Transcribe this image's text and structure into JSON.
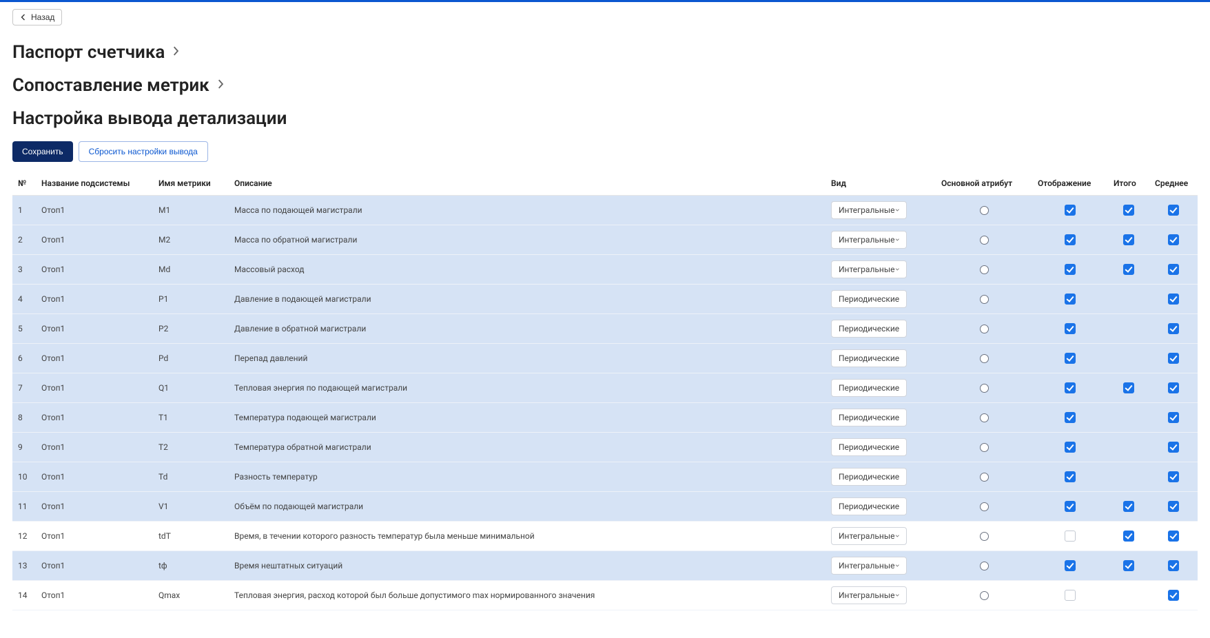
{
  "back_label": "Назад",
  "section1_title": "Паспорт счетчика",
  "section2_title": "Сопоставление метрик",
  "section3_title": "Настройка вывода детализации",
  "actions": {
    "save": "Сохранить",
    "reset": "Сбросить настройки вывода"
  },
  "table": {
    "headers": {
      "idx": "№",
      "subsystem": "Название подсистемы",
      "metric": "Имя метрики",
      "desc": "Описание",
      "kind": "Вид",
      "main_attr": "Основной атрибут",
      "display": "Отображение",
      "total": "Итого",
      "avg": "Среднее"
    },
    "kinds": {
      "integral": "Интегральные",
      "periodic": "Периодические"
    },
    "rows": [
      {
        "idx": "1",
        "sub": "Отоп1",
        "met": "M1",
        "desc": "Масса по подающей магистрали",
        "kind": "integral",
        "hl": true,
        "disp": true,
        "total": true,
        "avg": true
      },
      {
        "idx": "2",
        "sub": "Отоп1",
        "met": "M2",
        "desc": "Масса по обратной магистрали",
        "kind": "integral",
        "hl": true,
        "disp": true,
        "total": true,
        "avg": true
      },
      {
        "idx": "3",
        "sub": "Отоп1",
        "met": "Md",
        "desc": "Массовый расход",
        "kind": "integral",
        "hl": true,
        "disp": true,
        "total": true,
        "avg": true
      },
      {
        "idx": "4",
        "sub": "Отоп1",
        "met": "P1",
        "desc": "Давление в подающей магистрали",
        "kind": "periodic",
        "hl": true,
        "disp": true,
        "total": false,
        "avg": true
      },
      {
        "idx": "5",
        "sub": "Отоп1",
        "met": "P2",
        "desc": "Давление в обратной магистрали",
        "kind": "periodic",
        "hl": true,
        "disp": true,
        "total": false,
        "avg": true
      },
      {
        "idx": "6",
        "sub": "Отоп1",
        "met": "Pd",
        "desc": "Перепад давлений",
        "kind": "periodic",
        "hl": true,
        "disp": true,
        "total": false,
        "avg": true
      },
      {
        "idx": "7",
        "sub": "Отоп1",
        "met": "Q1",
        "desc": "Тепловая энергия по подающей магистрали",
        "kind": "periodic",
        "hl": true,
        "disp": true,
        "total": true,
        "avg": true
      },
      {
        "idx": "8",
        "sub": "Отоп1",
        "met": "T1",
        "desc": "Температура подающей магистрали",
        "kind": "periodic",
        "hl": true,
        "disp": true,
        "total": false,
        "avg": true
      },
      {
        "idx": "9",
        "sub": "Отоп1",
        "met": "T2",
        "desc": "Температура обратной магистрали",
        "kind": "periodic",
        "hl": true,
        "disp": true,
        "total": false,
        "avg": true
      },
      {
        "idx": "10",
        "sub": "Отоп1",
        "met": "Td",
        "desc": "Разность температур",
        "kind": "periodic",
        "hl": true,
        "disp": true,
        "total": false,
        "avg": true
      },
      {
        "idx": "11",
        "sub": "Отоп1",
        "met": "V1",
        "desc": "Объём по подающей магистрали",
        "kind": "periodic",
        "hl": true,
        "disp": true,
        "total": true,
        "avg": true
      },
      {
        "idx": "12",
        "sub": "Отоп1",
        "met": "tdT",
        "desc": "Время, в течении которого разность температур была меньше минимальной",
        "kind": "integral",
        "hl": false,
        "disp": false,
        "total": true,
        "avg": true
      },
      {
        "idx": "13",
        "sub": "Отоп1",
        "met": "tф",
        "desc": "Время нештатных ситуаций",
        "kind": "integral",
        "hl": true,
        "disp": true,
        "total": true,
        "avg": true
      },
      {
        "idx": "14",
        "sub": "Отоп1",
        "met": "Qmax",
        "desc": "Тепловая энергия, расход которой был больше допустимого max нормированного значения",
        "kind": "integral",
        "hl": false,
        "disp": false,
        "total": false,
        "avg": true
      }
    ]
  }
}
